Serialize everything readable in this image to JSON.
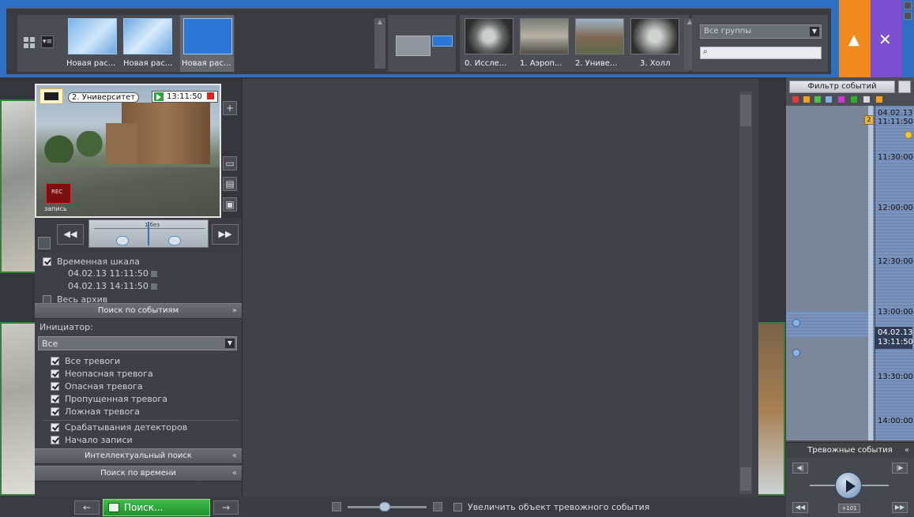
{
  "colors": {
    "topbar_bg": "#2e6fc4",
    "alarm_tab": "#f08a1f",
    "tools_tab": "#7b4fd0",
    "search_button": "#2aa53a",
    "timeline_blue": "#7d95bd",
    "camera_frame_green": "#3a7a3a"
  },
  "topbar": {
    "layouts": [
      {
        "label": "Новая рас..."
      },
      {
        "label": "Новая рас..."
      },
      {
        "label": "Новая рас..."
      }
    ],
    "cameras": [
      {
        "label": "0. Иссле..."
      },
      {
        "label": "1. Аэроп..."
      },
      {
        "label": "2. Униве..."
      },
      {
        "label": "3. Холл"
      }
    ],
    "groups_select": "Все группы",
    "search_icon": "search-icon",
    "alarm_icon": "bell-icon",
    "tools_icon": "tools-icon"
  },
  "camera_window": {
    "name": "2. Университет",
    "time": "13:11:50",
    "rec_label": "запись"
  },
  "playback": {
    "scale_label": "1 без"
  },
  "search": {
    "timeline_label": "Временная шкала",
    "date_from": "04.02.13 11:11:50",
    "date_to": "04.02.13 14:11:50",
    "whole_archive_label": "Весь архив",
    "events_section": "Поиск по событиям",
    "initiator_label": "Инициатор:",
    "initiator_value": "Все",
    "alarm_types": [
      "Все тревоги",
      "Неопасная тревога",
      "Опасная тревога",
      "Пропущенная тревога",
      "Ложная тревога"
    ],
    "detectors_label": "Срабатывания детекторов",
    "record_start_label": "Начало записи",
    "smart_search_section": "Интеллектуальный поиск",
    "time_search_section": "Поиск по времени"
  },
  "bottom": {
    "search_button": "Поиск...",
    "zoom_alarm_label": "Увеличить объект тревожного события"
  },
  "events_panel": {
    "filter_button": "Фильтр событий",
    "top_date": "04.02.13",
    "top_time": "11:11:50",
    "cursor_date": "04.02.13",
    "cursor_time": "13:11:50",
    "handle_number": "2",
    "time_labels": [
      "11:30:00",
      "12:00:00",
      "12:30:00",
      "13:00:00",
      "13:30:00",
      "14:00:00"
    ],
    "alarm_events_label": "Тревожные события",
    "speed_label": "+101"
  }
}
